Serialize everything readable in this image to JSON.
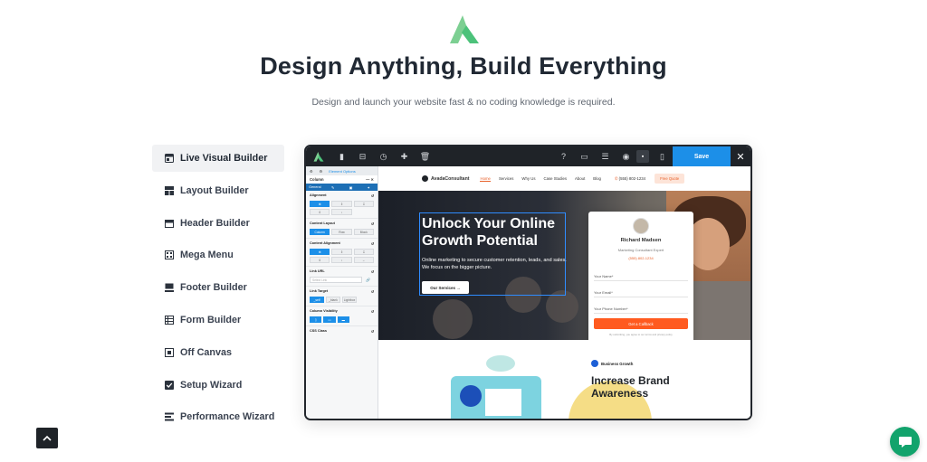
{
  "header": {
    "title": "Design Anything, Build Everything",
    "subtitle": "Design and launch your website fast & no coding knowledge is required."
  },
  "features": [
    {
      "label": "Live Visual Builder",
      "icon": "live-builder-icon",
      "active": true
    },
    {
      "label": "Layout Builder",
      "icon": "layout-icon",
      "active": false
    },
    {
      "label": "Header Builder",
      "icon": "header-icon",
      "active": false
    },
    {
      "label": "Mega Menu",
      "icon": "mega-menu-icon",
      "active": false
    },
    {
      "label": "Footer Builder",
      "icon": "footer-icon",
      "active": false
    },
    {
      "label": "Form Builder",
      "icon": "form-icon",
      "active": false
    },
    {
      "label": "Off Canvas",
      "icon": "off-canvas-icon",
      "active": false
    },
    {
      "label": "Setup Wizard",
      "icon": "checkbox-icon",
      "active": false
    },
    {
      "label": "Performance Wizard",
      "icon": "performance-icon",
      "active": false
    }
  ],
  "builder": {
    "save_label": "Save",
    "close_label": "✕",
    "panel": {
      "tabs": [
        "Element Options"
      ],
      "title": "Column",
      "subtabs": [
        "General",
        "Design",
        "BG",
        "Extras"
      ],
      "alignment_label": "Alignment",
      "content_layout_label": "Content Layout",
      "content_layout_options": [
        "Column",
        "Row",
        "Block"
      ],
      "content_alignment_label": "Content Alignment",
      "link_url_label": "Link URL",
      "link_url_placeholder": "Select Link",
      "link_target_label": "Link Target",
      "link_target_options": [
        "_self",
        "_blank",
        "Lightbox"
      ],
      "column_visibility_label": "Column Visibility",
      "css_class_label": "CSS Class"
    },
    "preview": {
      "brand": "AvadaConsultant",
      "nav": [
        "Home",
        "Services",
        "Why Us",
        "Case Studies",
        "About",
        "Blog"
      ],
      "phone": "(555) 802-1234",
      "quote_button": "Free Quote",
      "hero_title": "Unlock Your Online Growth Potential",
      "hero_text": "Online marketing to secure customer retention, leads, and sales. We focus on the bigger picture.",
      "hero_button": "Our Services",
      "card": {
        "name": "Richard Madsen",
        "role": "Marketing Consultant Expert",
        "phone": "(555) 802-1234",
        "fields": [
          "Your Name*",
          "Your Email*",
          "Your Phone Number*"
        ],
        "button": "Get a Callback",
        "fine_print": "By submitting, you agree to our terms and privacy policy"
      },
      "section_badge": "Business Growth",
      "section_title": "Increase Brand Awareness"
    }
  },
  "colors": {
    "accent": "#4cc27a",
    "primary_blue": "#1c8fe8",
    "orange": "#ff5a1f",
    "chat_green": "#12a36c"
  }
}
